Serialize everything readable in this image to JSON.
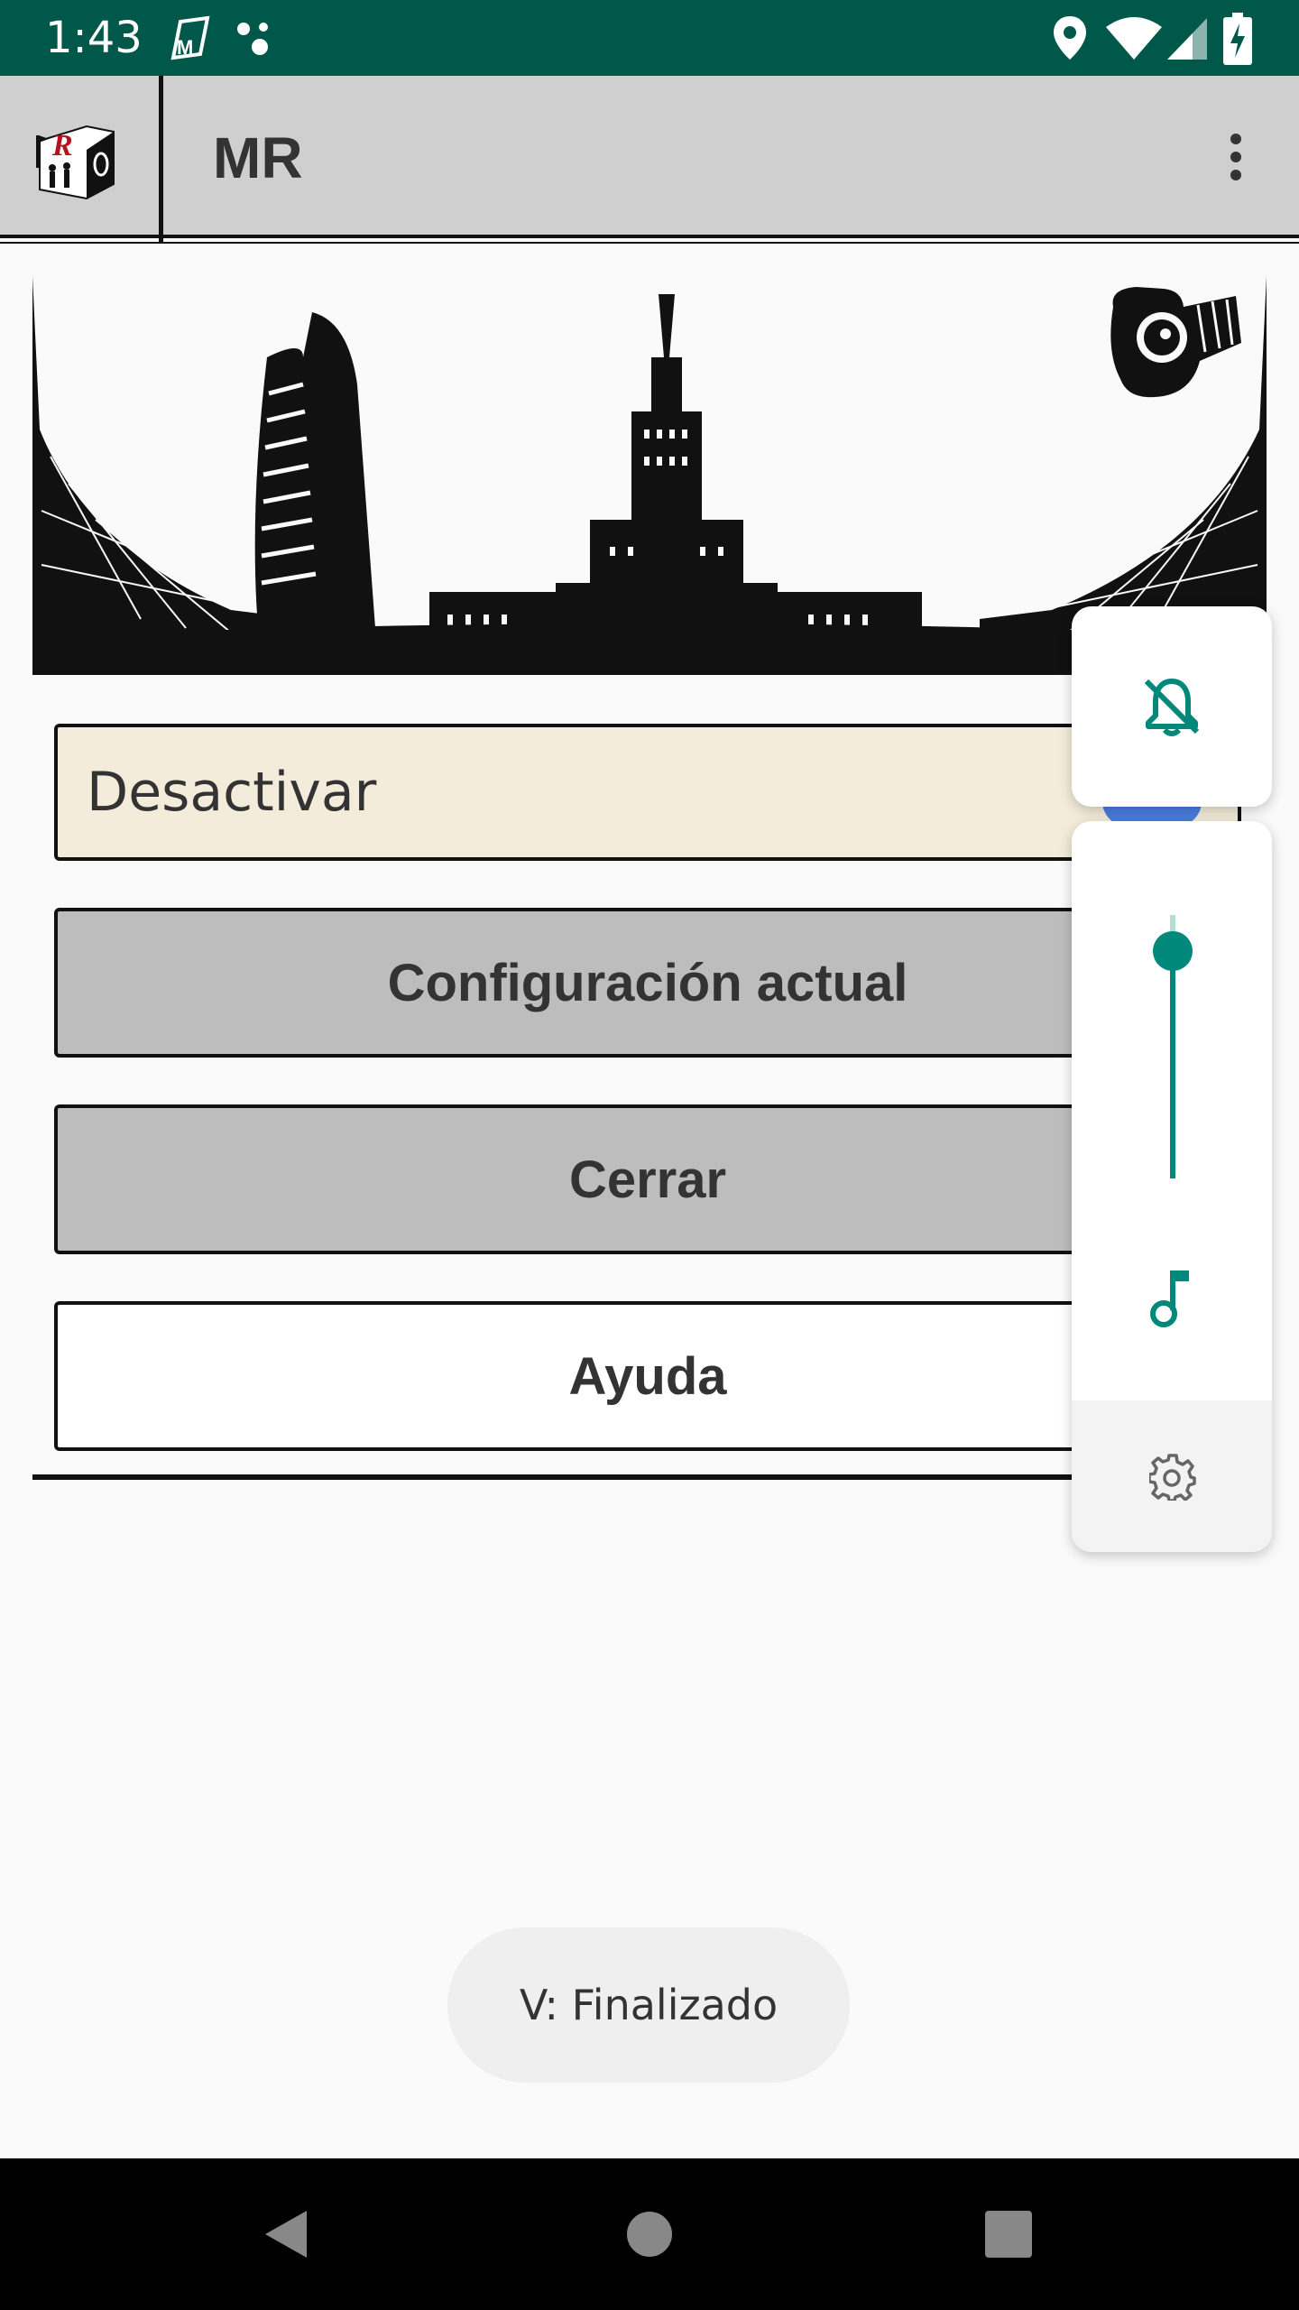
{
  "status_bar": {
    "time": "1:43",
    "icons": [
      "app-notification-icon",
      "assistant-dots-icon",
      "location-icon",
      "wifi-icon",
      "signal-icon",
      "battery-charging-icon"
    ]
  },
  "app_bar": {
    "title": "MR",
    "menu_icon": "more-vert-icon"
  },
  "main": {
    "banner_icons": [
      "city-skyline-image",
      "camera-image"
    ],
    "buttons": {
      "desactivar": "Desactivar",
      "configuracion": "Configuración actual",
      "cerrar": "Cerrar",
      "ayuda": "Ayuda"
    }
  },
  "volume_panel": {
    "ringer_icon": "bell-off-icon",
    "stream_icon": "music-note-icon",
    "settings_icon": "gear-icon",
    "level_fraction": 0.88,
    "accent_color": "#00897b"
  },
  "toast": {
    "text": "V: Finalizado"
  },
  "nav_bar": {
    "icons": [
      "back-icon",
      "home-icon",
      "recents-icon"
    ]
  },
  "colors": {
    "status_bar": "#00584a",
    "app_bar": "#cfcfcf",
    "desactivar_bg": "#f3ecda",
    "button_gray": "#bdbdbd"
  }
}
